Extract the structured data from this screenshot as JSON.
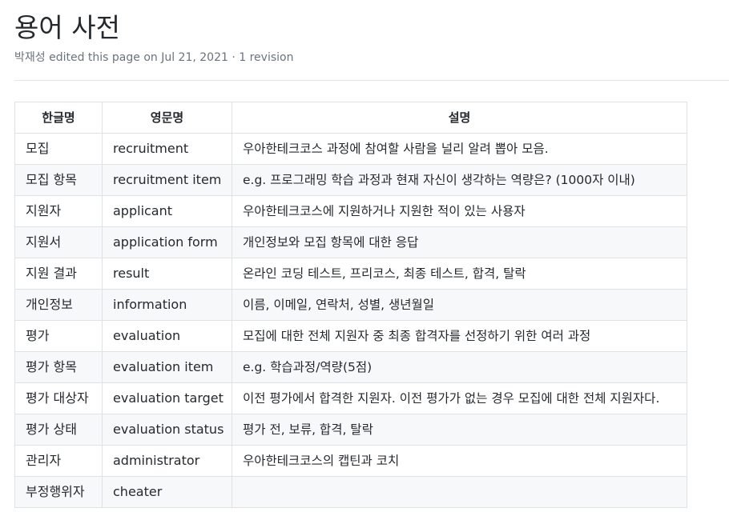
{
  "page": {
    "title": "용어 사전",
    "meta": "박재성 edited this page on Jul 21, 2021 · 1 revision"
  },
  "table": {
    "headers": [
      "한글명",
      "영문명",
      "설명"
    ],
    "rows": [
      [
        "모집",
        "recruitment",
        "우아한테크코스 과정에 참여할 사람을 널리 알려 뽑아 모음."
      ],
      [
        "모집 항목",
        "recruitment item",
        "e.g. 프로그래밍 학습 과정과 현재 자신이 생각하는 역량은? (1000자 이내)"
      ],
      [
        "지원자",
        "applicant",
        "우아한테크코스에 지원하거나 지원한 적이 있는 사용자"
      ],
      [
        "지원서",
        "application form",
        "개인정보와 모집 항목에 대한 응답"
      ],
      [
        "지원 결과",
        "result",
        "온라인 코딩 테스트, 프리코스, 최종 테스트, 합격, 탈락"
      ],
      [
        "개인정보",
        "information",
        "이름, 이메일, 연락처, 성별, 생년월일"
      ],
      [
        "평가",
        "evaluation",
        "모집에 대한 전체 지원자 중 최종 합격자를 선정하기 위한 여러 과정"
      ],
      [
        "평가 항목",
        "evaluation item",
        "e.g. 학습과정/역량(5점)"
      ],
      [
        "평가 대상자",
        "evaluation target",
        "이전 평가에서 합격한 지원자. 이전 평가가 없는 경우 모집에 대한 전체 지원자다."
      ],
      [
        "평가 상태",
        "evaluation status",
        "평가 전, 보류, 합격, 탈락"
      ],
      [
        "관리자",
        "administrator",
        "우아한테크코스의 캡틴과 코치"
      ],
      [
        "부정행위자",
        "cheater",
        ""
      ]
    ]
  }
}
